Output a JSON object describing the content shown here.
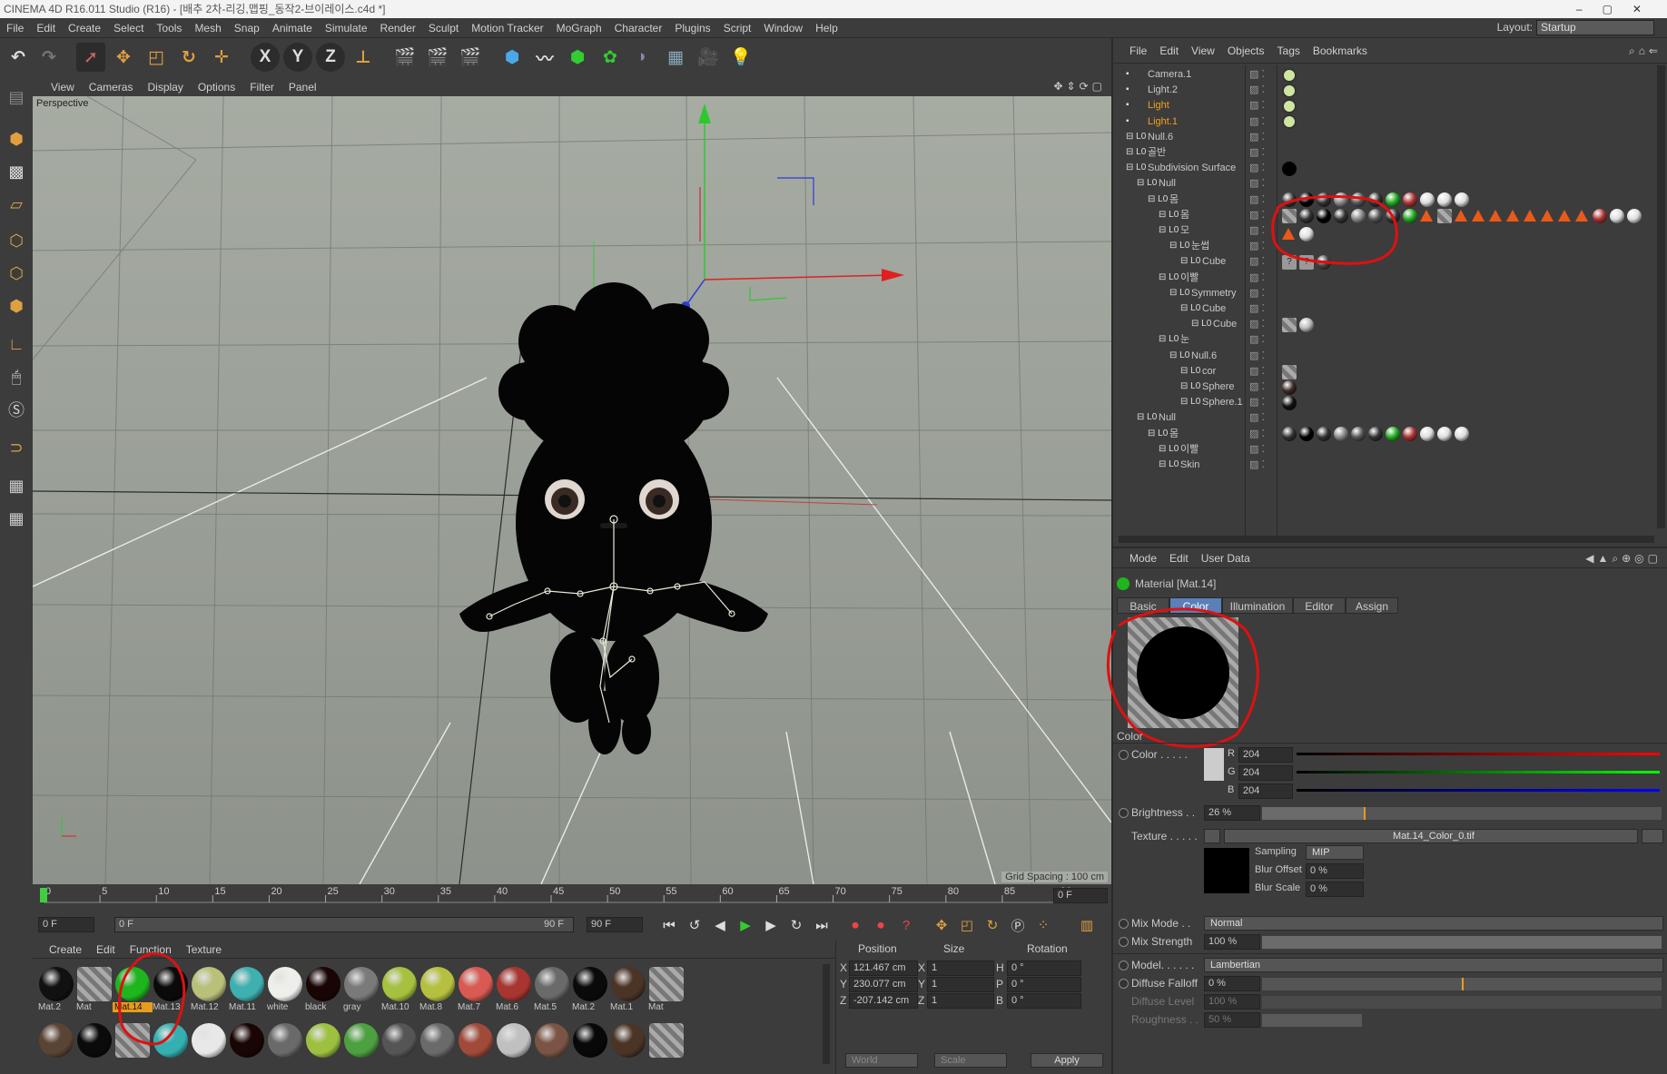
{
  "titlebar": {
    "title": "CINEMA 4D R16.011 Studio (R16) - [배추 2차-리깅,맵핑_동작2-브이레이스.c4d *]"
  },
  "menubar": {
    "items": [
      "File",
      "Edit",
      "Create",
      "Select",
      "Tools",
      "Mesh",
      "Snap",
      "Animate",
      "Simulate",
      "Render",
      "Sculpt",
      "Motion Tracker",
      "MoGraph",
      "Character",
      "Plugins",
      "Script",
      "Window",
      "Help"
    ],
    "layout_label": "Layout:",
    "layout_value": "Startup"
  },
  "viewport": {
    "menu": [
      "View",
      "Cameras",
      "Display",
      "Options",
      "Filter",
      "Panel"
    ],
    "label": "Perspective",
    "grid_spacing": "Grid Spacing : 100 cm"
  },
  "timeline": {
    "ticks": [
      "0",
      "5",
      "10",
      "15",
      "20",
      "25",
      "30",
      "35",
      "40",
      "45",
      "50",
      "55",
      "60",
      "65",
      "70",
      "75",
      "80",
      "85",
      "90"
    ],
    "current_frame": "0 F",
    "start": "0 F",
    "range_start": "0 F",
    "range_end": "90 F",
    "end": "90 F"
  },
  "materials": {
    "menu": [
      "Create",
      "Edit",
      "Function",
      "Texture"
    ],
    "row1": [
      {
        "name": "Mat.2",
        "color": "#111111"
      },
      {
        "name": "Mat",
        "color": "checker"
      },
      {
        "name": "Mat.14",
        "color": "#1fb51f",
        "selected": true
      },
      {
        "name": "Mat.13",
        "color": "#0a0a0a"
      },
      {
        "name": "Mat.12",
        "color": "#b9c07a"
      },
      {
        "name": "Mat.11",
        "color": "#3fb0b0"
      },
      {
        "name": "white",
        "color": "#eeeeea"
      },
      {
        "name": "black",
        "color": "#1a0505"
      },
      {
        "name": "gray",
        "color": "#7a7a7a"
      },
      {
        "name": "Mat.10",
        "color": "#a6c040"
      },
      {
        "name": "Mat.8",
        "color": "#b5c040"
      },
      {
        "name": "Mat.7",
        "color": "#d85a52"
      },
      {
        "name": "Mat.6",
        "color": "#a83530"
      },
      {
        "name": "Mat.5",
        "color": "#6a6a6a"
      },
      {
        "name": "Mat.2",
        "color": "#0a0a0a"
      },
      {
        "name": "Mat.1",
        "color": "#4a3426"
      },
      {
        "name": "Mat",
        "color": "checker"
      }
    ],
    "row2": [
      "#5a4434",
      "#0b0b0b",
      "checker",
      "#35b0b0",
      "#e8e8e8",
      "#1a0505",
      "#6a6a6a",
      "#9dc040",
      "#4ca040",
      "#555555",
      "#6a6a6a",
      "#a04a3a",
      "#c0c0c0",
      "#7a5444",
      "#080808",
      "#4a3426",
      "checker"
    ]
  },
  "coords": {
    "headers": [
      "Position",
      "Size",
      "Rotation"
    ],
    "rows": [
      {
        "axis": "X",
        "pos": "121.467 cm",
        "sax": "X",
        "size": "1",
        "rax": "H",
        "rot": "0 °"
      },
      {
        "axis": "Y",
        "pos": "230.077 cm",
        "sax": "Y",
        "size": "1",
        "rax": "P",
        "rot": "0 °"
      },
      {
        "axis": "Z",
        "pos": "-207.142 cm",
        "sax": "Z",
        "size": "1",
        "rax": "B",
        "rot": "0 °"
      }
    ],
    "world": "World",
    "scale": "Scale",
    "apply": "Apply"
  },
  "objects": {
    "menu": [
      "File",
      "Edit",
      "View",
      "Objects",
      "Tags",
      "Bookmarks"
    ],
    "rows": [
      {
        "name": "Camera.1",
        "indent": 0
      },
      {
        "name": "Light.2",
        "indent": 0
      },
      {
        "name": "Light",
        "indent": 0,
        "orange": true
      },
      {
        "name": "Light.1",
        "indent": 0,
        "orange": true
      },
      {
        "name": "Null.6",
        "indent": 0
      },
      {
        "name": "골반",
        "indent": 0
      },
      {
        "name": "Subdivision Surface",
        "indent": 0
      },
      {
        "name": "Null",
        "indent": 1
      },
      {
        "name": "몸",
        "indent": 2
      },
      {
        "name": "몸",
        "indent": 3
      },
      {
        "name": "모",
        "indent": 3
      },
      {
        "name": "눈썹",
        "indent": 4
      },
      {
        "name": "Cube",
        "indent": 5
      },
      {
        "name": "이빨",
        "indent": 3
      },
      {
        "name": "Symmetry",
        "indent": 4
      },
      {
        "name": "Cube",
        "indent": 5
      },
      {
        "name": "Cube",
        "indent": 6
      },
      {
        "name": "눈",
        "indent": 3
      },
      {
        "name": "Null.6",
        "indent": 4
      },
      {
        "name": "cor",
        "indent": 5
      },
      {
        "name": "Sphere",
        "indent": 5
      },
      {
        "name": "Sphere.1",
        "indent": 5
      },
      {
        "name": "Null",
        "indent": 1
      },
      {
        "name": "몸",
        "indent": 2
      },
      {
        "name": "이빨",
        "indent": 3
      },
      {
        "name": "Skin",
        "indent": 3
      }
    ]
  },
  "attributes": {
    "menu": [
      "Mode",
      "Edit",
      "User Data"
    ],
    "title": "Material [Mat.14]",
    "tabs": [
      "Basic",
      "Color",
      "Illumination",
      "Editor",
      "Assign"
    ],
    "active_tab": "Color",
    "section": "Color",
    "color_label": "Color . . . . .",
    "r": "204",
    "g": "204",
    "b": "204",
    "r_label": "R",
    "g_label": "G",
    "b_label": "B",
    "brightness_label": "Brightness . .",
    "brightness": "26 %",
    "brightness_value": 26,
    "texture_label": "Texture . . . . .",
    "texture": "Mat.14_Color_0.tif",
    "sampling_label": "Sampling",
    "sampling": "MIP",
    "blur_offset_label": "Blur Offset",
    "blur_offset": "0 %",
    "blur_scale_label": "Blur Scale",
    "blur_scale": "0 %",
    "mix_mode_label": "Mix Mode . .",
    "mix_mode": "Normal",
    "mix_strength_label": "Mix Strength",
    "mix_strength": "100 %",
    "mix_strength_value": 100,
    "model_label": "Model. . . . . .",
    "model": "Lambertian",
    "diffuse_falloff_label": "Diffuse Falloff",
    "diffuse_falloff": "0 %",
    "diffuse_level_label": "Diffuse Level",
    "diffuse_level": "100 %",
    "roughness_label": "Roughness . .",
    "roughness": "50 %"
  },
  "colors": {
    "accent": "#5b7fb8",
    "highlight": "#e89c1e",
    "annotation": "#e01010"
  }
}
